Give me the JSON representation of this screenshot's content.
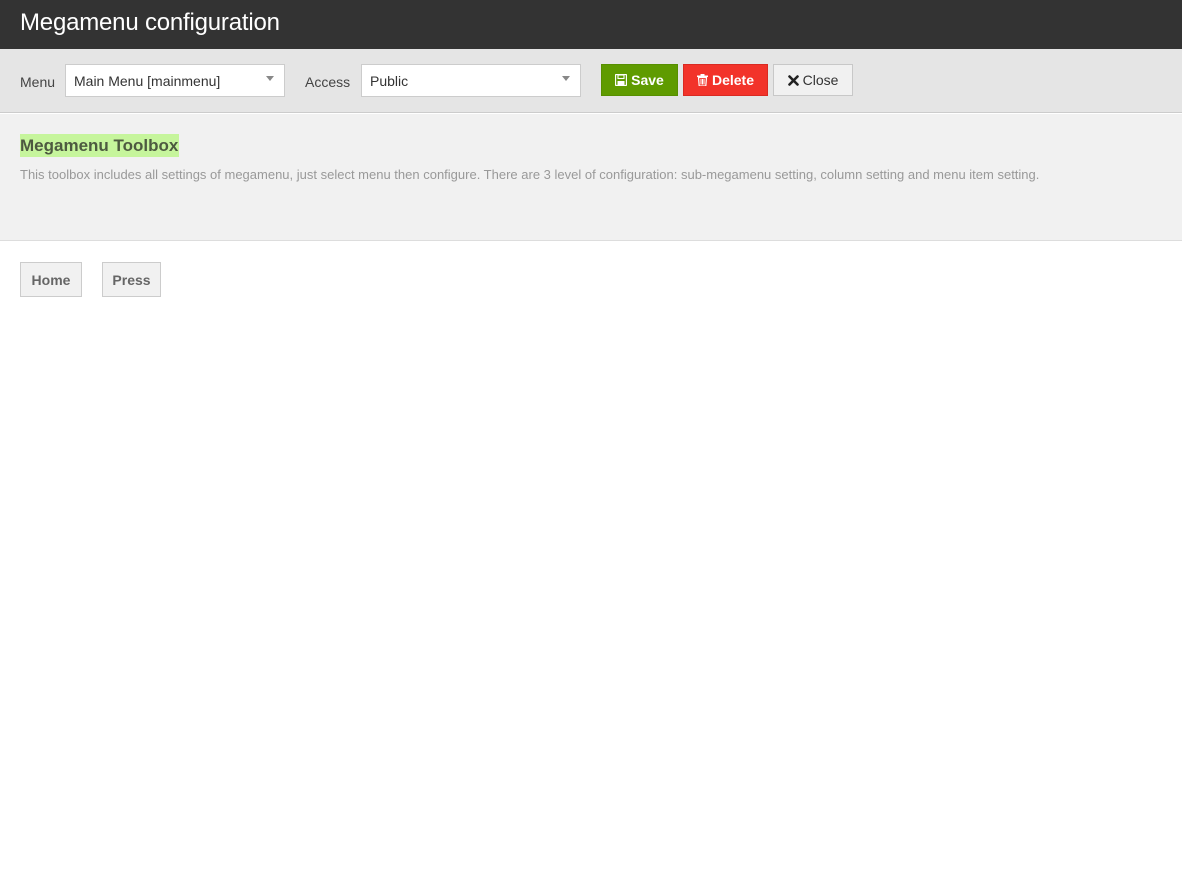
{
  "header": {
    "title": "Megamenu configuration"
  },
  "toolbar": {
    "menu_label": "Menu",
    "menu_value": "Main Menu [mainmenu]",
    "access_label": "Access",
    "access_value": "Public",
    "save_label": "Save",
    "delete_label": "Delete",
    "close_label": "Close",
    "save_icon": "floppy-disk-icon",
    "delete_icon": "trash-icon",
    "close_icon": "x-icon"
  },
  "toolbox": {
    "title": "Megamenu Toolbox",
    "description": "This toolbox includes all settings of megamenu, just select menu then configure. There are 3 level of configuration: sub-megamenu setting, column setting and menu item setting."
  },
  "menu_items": [
    {
      "label": "Home"
    },
    {
      "label": "Press"
    }
  ],
  "colors": {
    "header_bg": "#333333",
    "save": "#5f9b00",
    "delete": "#f2332a",
    "highlight": "#c6f59c"
  }
}
